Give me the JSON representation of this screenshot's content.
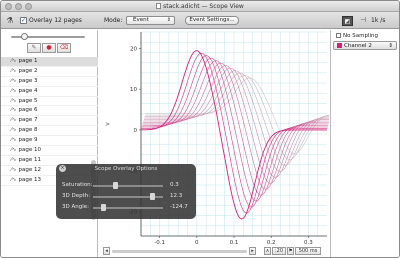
{
  "window": {
    "title": "stack.adicht — Scope View"
  },
  "toolbar": {
    "overlay_checked": true,
    "overlay_label": "Overlay 12 pages",
    "mode_label": "Mode:",
    "mode_value": "Event",
    "event_settings_label": "Event Settings...",
    "rate_value": "1k /s"
  },
  "sidebar": {
    "pages": [
      "page 1",
      "page 2",
      "page 3",
      "page 4",
      "page 5",
      "page 6",
      "page 7",
      "page 8",
      "page 9",
      "page 10",
      "page 11",
      "page 12",
      "page 13"
    ],
    "selected_index": 0,
    "overlay_slider_fraction": 0.15
  },
  "right_panel": {
    "sampling_label": "No Sampling",
    "channel_label": "Channel 2"
  },
  "dialog": {
    "title": "Scope Overlay Options",
    "rows": [
      {
        "label": "Saturation:",
        "value": "0.3",
        "fraction": 0.3
      },
      {
        "label": "3D Depth:",
        "value": "12.3",
        "fraction": 0.86
      },
      {
        "label": "3D Angle:",
        "value": "-124.7",
        "fraction": 0.12
      }
    ]
  },
  "bottom": {
    "timebase_value": "500 ms",
    "zoom_value": ":20"
  },
  "chart_data": {
    "type": "line",
    "x_ticks": [
      "-0.1",
      "0",
      "0.1",
      "0.2",
      "0.3"
    ],
    "y_ticks": [
      "20",
      "10",
      "0",
      "-10",
      "-20"
    ],
    "xlim": [
      -0.15,
      0.35
    ],
    "ylim": [
      -26,
      24
    ],
    "grid": true,
    "colors": {
      "grid": "#bfe6ee",
      "trace_start": "#d11f7a",
      "trace_end": "#c9c9c9"
    }
  }
}
